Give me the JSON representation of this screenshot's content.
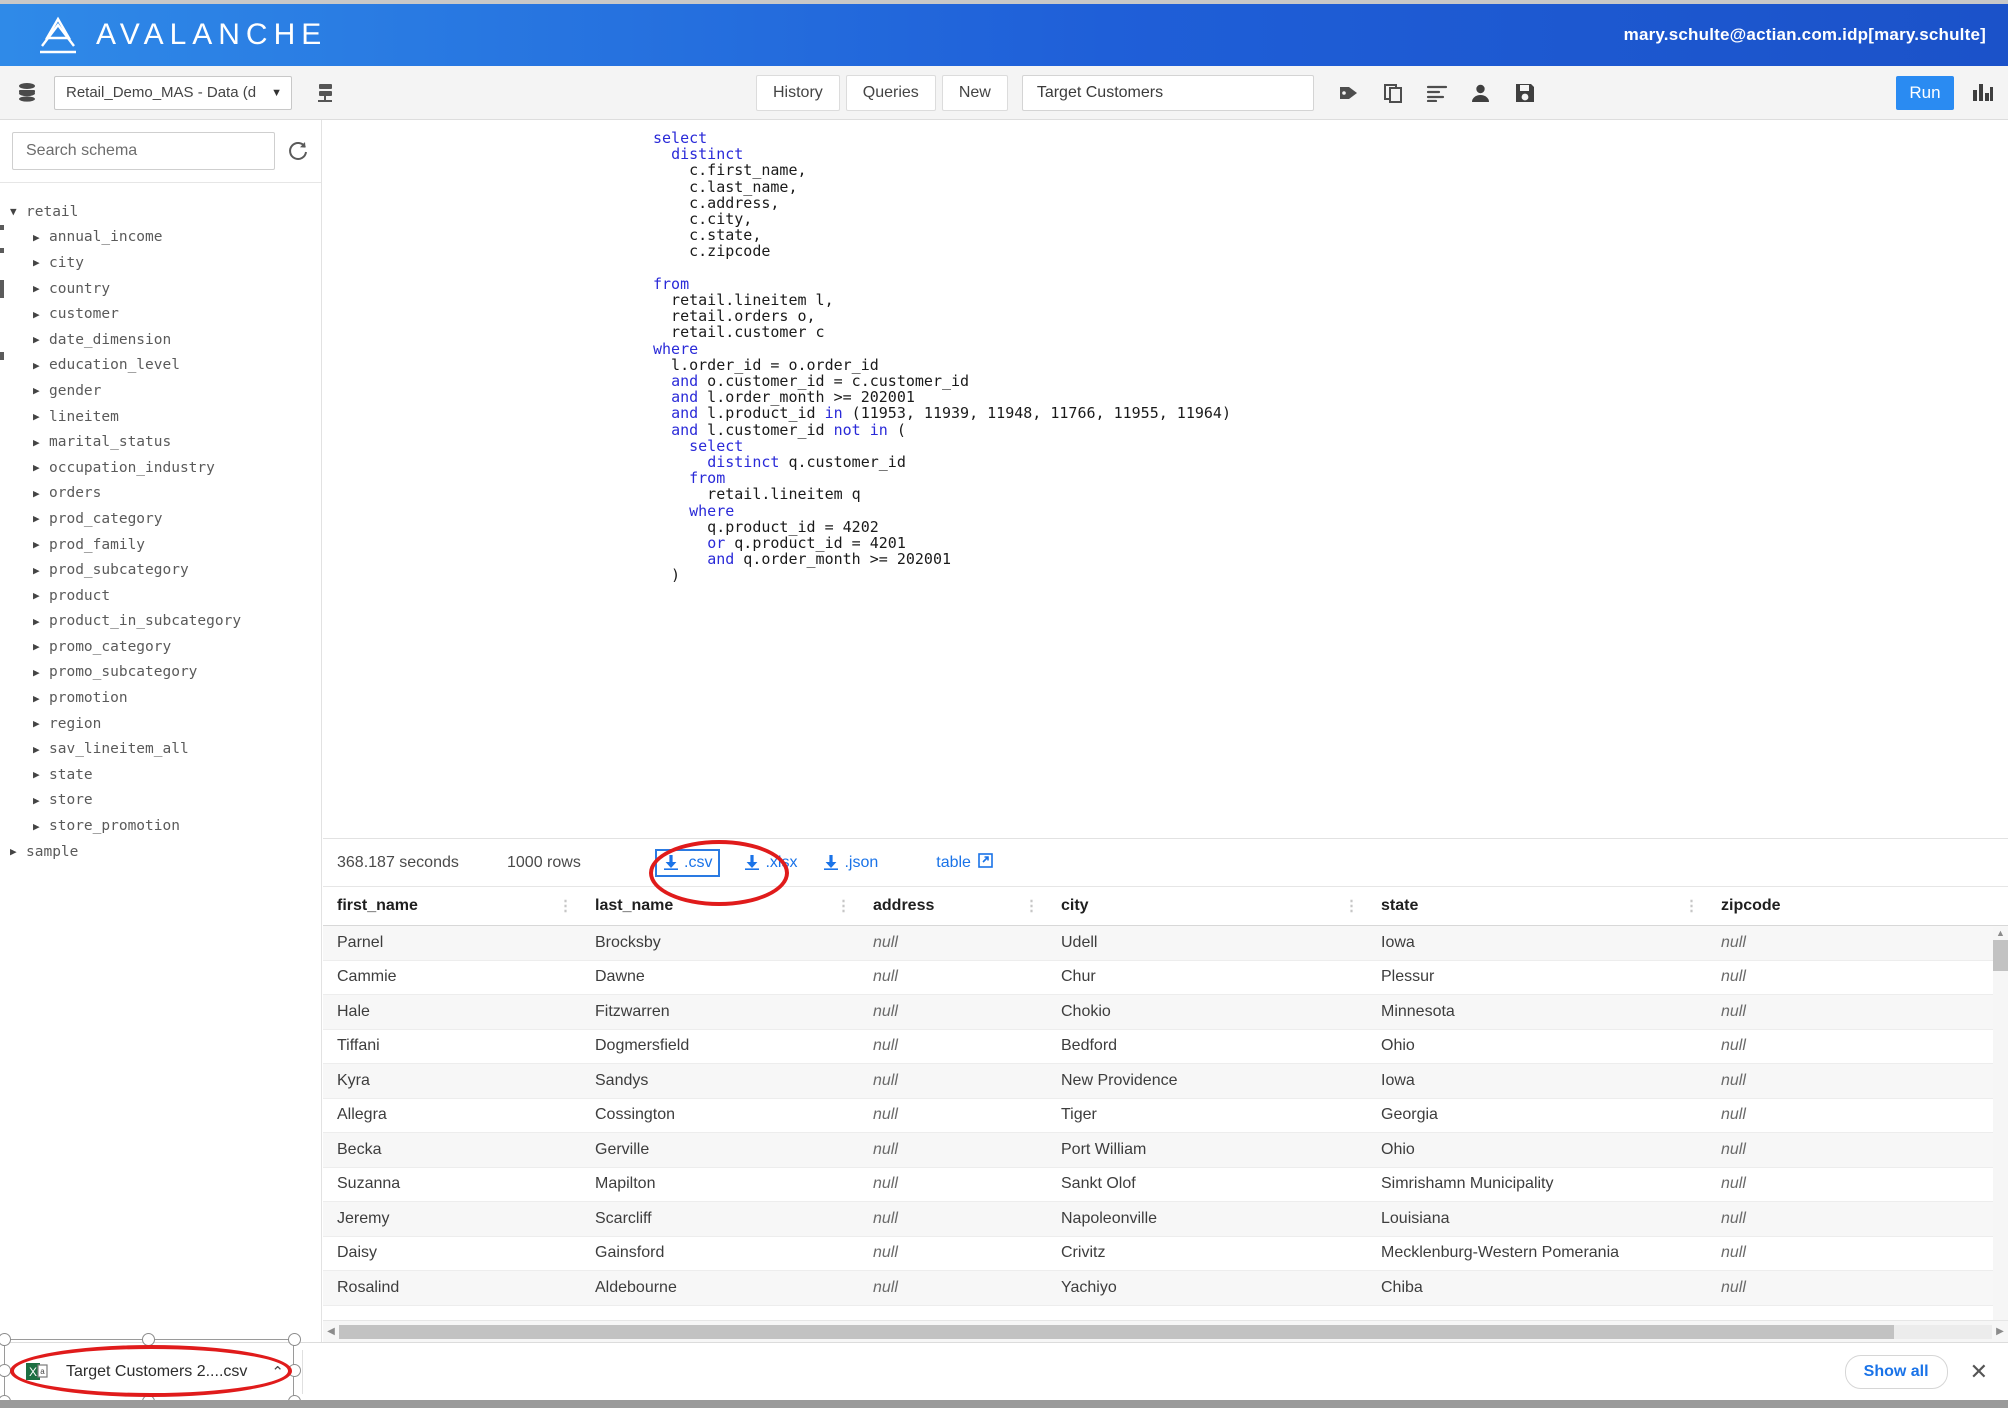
{
  "brand": {
    "name": "AVALANCHE",
    "logo_icon": "avalanche-mountain-icon",
    "user": "mary.schulte@actian.com.idp[mary.schulte]"
  },
  "toolbar": {
    "db_icon": "database-icon",
    "database": "Retail_Demo_MAS - Data (d",
    "caret": "▼",
    "server_icon": "server-icon",
    "history_label": "History",
    "queries_label": "Queries",
    "new_label": "New",
    "query_name": "Target Customers",
    "icons": [
      "tag-icon",
      "copy-icon",
      "format-align-icon",
      "person-icon",
      "save-icon"
    ],
    "run_label": "Run",
    "chart_icon": "bar-chart-icon"
  },
  "sidebar": {
    "search_placeholder": "Search schema",
    "refresh_icon": "refresh-icon",
    "tree": [
      {
        "label": "retail",
        "expanded": true,
        "arrow": "▼",
        "level": 0
      },
      {
        "label": "annual_income",
        "arrow": "▶",
        "level": 1
      },
      {
        "label": "city",
        "arrow": "▶",
        "level": 1
      },
      {
        "label": "country",
        "arrow": "▶",
        "level": 1
      },
      {
        "label": "customer",
        "arrow": "▶",
        "level": 1
      },
      {
        "label": "date_dimension",
        "arrow": "▶",
        "level": 1
      },
      {
        "label": "education_level",
        "arrow": "▶",
        "level": 1
      },
      {
        "label": "gender",
        "arrow": "▶",
        "level": 1
      },
      {
        "label": "lineitem",
        "arrow": "▶",
        "level": 1
      },
      {
        "label": "marital_status",
        "arrow": "▶",
        "level": 1
      },
      {
        "label": "occupation_industry",
        "arrow": "▶",
        "level": 1
      },
      {
        "label": "orders",
        "arrow": "▶",
        "level": 1
      },
      {
        "label": "prod_category",
        "arrow": "▶",
        "level": 1
      },
      {
        "label": "prod_family",
        "arrow": "▶",
        "level": 1
      },
      {
        "label": "prod_subcategory",
        "arrow": "▶",
        "level": 1
      },
      {
        "label": "product",
        "arrow": "▶",
        "level": 1
      },
      {
        "label": "product_in_subcategory",
        "arrow": "▶",
        "level": 1
      },
      {
        "label": "promo_category",
        "arrow": "▶",
        "level": 1
      },
      {
        "label": "promo_subcategory",
        "arrow": "▶",
        "level": 1
      },
      {
        "label": "promotion",
        "arrow": "▶",
        "level": 1
      },
      {
        "label": "region",
        "arrow": "▶",
        "level": 1
      },
      {
        "label": "sav_lineitem_all",
        "arrow": "▶",
        "level": 1
      },
      {
        "label": "state",
        "arrow": "▶",
        "level": 1
      },
      {
        "label": "store",
        "arrow": "▶",
        "level": 1
      },
      {
        "label": "store_promotion",
        "arrow": "▶",
        "level": 1
      },
      {
        "label": "sample",
        "arrow": "▶",
        "level": 0
      }
    ]
  },
  "editor": {
    "sql": "select\n  distinct\n    c.first_name,\n    c.last_name,\n    c.address,\n    c.city,\n    c.state,\n    c.zipcode\n\nfrom\n  retail.lineitem l,\n  retail.orders o,\n  retail.customer c\nwhere\n  l.order_id = o.order_id\n  and o.customer_id = c.customer_id\n  and l.order_month >= 202001\n  and l.product_id in (11953, 11939, 11948, 11766, 11955, 11964)\n  and l.customer_id not in (\n    select\n      distinct q.customer_id\n    from\n      retail.lineitem q\n    where\n      q.product_id = 4202\n      or q.product_id = 4201\n      and q.order_month >= 202001\n  )",
    "keywords": [
      "select",
      "distinct",
      "from",
      "where",
      "and",
      "or",
      "not",
      "in"
    ]
  },
  "results": {
    "seconds": "368.187 seconds",
    "rows": "1000 rows",
    "exports": [
      {
        "label": ".csv",
        "icon": "download-icon",
        "focused": true
      },
      {
        "label": ".xlsx",
        "icon": "download-icon",
        "focused": false
      },
      {
        "label": ".json",
        "icon": "download-icon",
        "focused": false
      }
    ],
    "table_link": "table",
    "table_link_icon": "external-link-icon",
    "columns": [
      "first_name",
      "last_name",
      "address",
      "city",
      "state",
      "zipcode"
    ],
    "rows_data": [
      [
        "Parnel",
        "Brocksby",
        "null",
        "Udell",
        "Iowa",
        "null"
      ],
      [
        "Cammie",
        "Dawne",
        "null",
        "Chur",
        "Plessur",
        "null"
      ],
      [
        "Hale",
        "Fitzwarren",
        "null",
        "Chokio",
        "Minnesota",
        "null"
      ],
      [
        "Tiffani",
        "Dogmersfield",
        "null",
        "Bedford",
        "Ohio",
        "null"
      ],
      [
        "Kyra",
        "Sandys",
        "null",
        "New Providence",
        "Iowa",
        "null"
      ],
      [
        "Allegra",
        "Cossington",
        "null",
        "Tiger",
        "Georgia",
        "null"
      ],
      [
        "Becka",
        "Gerville",
        "null",
        "Port William",
        "Ohio",
        "null"
      ],
      [
        "Suzanna",
        "Mapilton",
        "null",
        "Sankt Olof",
        "Simrishamn Municipality",
        "null"
      ],
      [
        "Jeremy",
        "Scarcliff",
        "null",
        "Napoleonville",
        "Louisiana",
        "null"
      ],
      [
        "Daisy",
        "Gainsford",
        "null",
        "Crivitz",
        "Mecklenburg-Western Pomerania",
        "null"
      ],
      [
        "Rosalind",
        "Aldebourne",
        "null",
        "Yachiyo",
        "Chiba",
        "null"
      ]
    ]
  },
  "download_bar": {
    "file_icon": "excel-file-icon",
    "file_name": "Target Customers 2....csv",
    "caret": "⌃",
    "show_all": "Show all",
    "close_icon": "close-icon"
  },
  "annotations": {
    "csv_highlight_color": "#e01b1b",
    "download_highlight_color": "#e01b1b"
  },
  "colors": {
    "brand_blue": "#1f5fd8",
    "accent_blue": "#2a8bf2",
    "link_blue": "#1a73e8",
    "annotation_red": "#e01b1b"
  }
}
